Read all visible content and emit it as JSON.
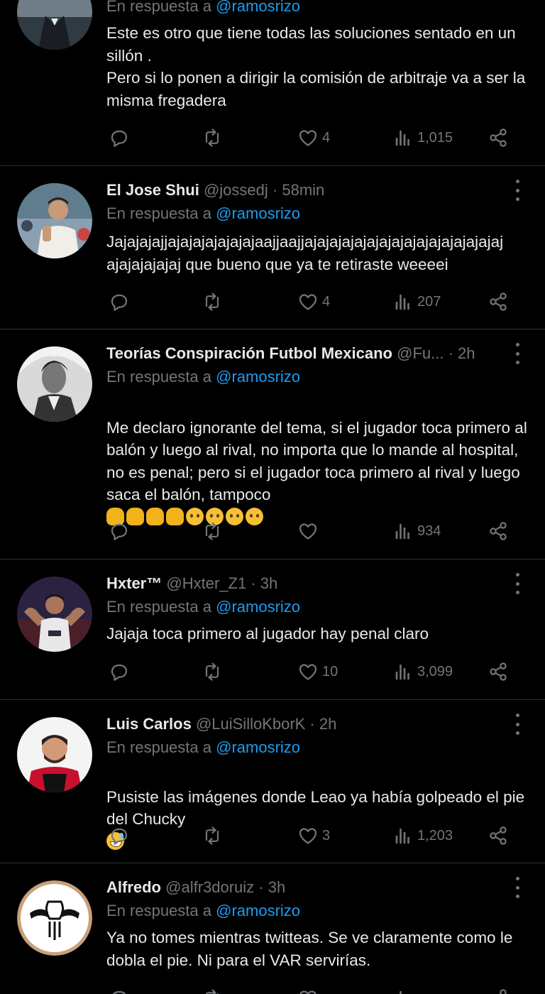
{
  "colors": {
    "background": "#000000",
    "text": "#e7e9ea",
    "muted": "#71767b",
    "link": "#1d9bf0",
    "divider": "#2f3336"
  },
  "icons": {
    "reply": "reply-icon",
    "retweet": "retweet-icon",
    "like": "heart-icon",
    "views": "views-icon",
    "share": "share-icon",
    "more": "more-icon"
  },
  "tweets": [
    {
      "name": "",
      "handle": "",
      "time": "",
      "reply_prefix": "En respuesta a ",
      "reply_handle": "@ramosrizo",
      "text": "Este es otro que tiene todas las soluciones sentado en un sillón .\nPero si lo ponen a dirigir la comisión de arbitraje va a ser la misma fregadera",
      "likes": "4",
      "views": "1,015"
    },
    {
      "name": "El Jose Shui",
      "handle": "@jossedj",
      "time": "· 58min",
      "reply_prefix": "En respuesta a ",
      "reply_handle": "@ramosrizo",
      "text": "Jajajajajjajajajajajajajaajjaajjajajajajajajajajajajajajajajajaj\najajajajajaj que bueno que ya te retiraste weeeei",
      "likes": "4",
      "views": "207"
    },
    {
      "name": "Teorías Conspiración Futbol Mexicano",
      "handle": "@Fu...",
      "time": "· 2h",
      "reply_prefix": "En respuesta a ",
      "reply_handle": "@ramosrizo",
      "text": "Me declaro ignorante del tema, si el jugador toca primero al balón y luego al rival, no importa que lo mande al hospital, no es penal; pero si el jugador toca primero al rival y luego saca el balón, tampoco",
      "emojis": [
        "shrug",
        "shrug",
        "shrug",
        "shrug",
        "raised-eyebrow",
        "raised-eyebrow",
        "raised-eyebrow",
        "raised-eyebrow"
      ],
      "likes": "",
      "views": "934"
    },
    {
      "name": "Hxter™",
      "handle": "@Hxter_Z1",
      "time": "· 3h",
      "reply_prefix": "En respuesta a ",
      "reply_handle": "@ramosrizo",
      "text": "Jajaja toca primero al jugador hay penal claro",
      "likes": "10",
      "views": "3,099"
    },
    {
      "name": "Luis Carlos",
      "handle": "@LuiSilloKborK",
      "time": "· 2h",
      "reply_prefix": "En respuesta a ",
      "reply_handle": "@ramosrizo",
      "text": "Pusiste las imágenes donde Leao ya había golpeado el pie del Chucky",
      "emojis": [
        "sweat-smile"
      ],
      "likes": "3",
      "views": "1,203"
    },
    {
      "name": "Alfredo",
      "handle": "@alfr3doruiz",
      "time": "· 3h",
      "reply_prefix": "En respuesta a ",
      "reply_handle": "@ramosrizo",
      "text": "Ya no tomes mientras twitteas. Se ve claramente como le dobla el pie.  Ni para el VAR servirías.",
      "likes": "",
      "views": ""
    }
  ]
}
